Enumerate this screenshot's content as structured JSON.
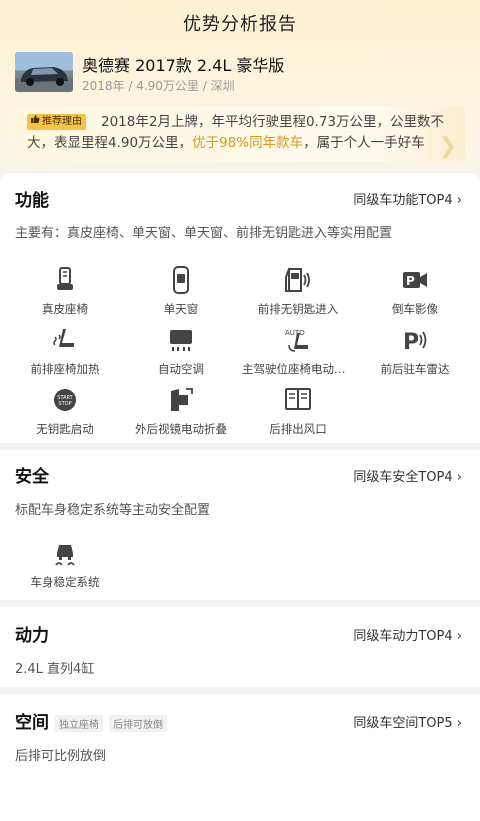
{
  "header": {
    "title": "优势分析报告"
  },
  "car": {
    "name": "奥德赛 2017款 2.4L 豪华版",
    "meta": "2018年 / 4.90万公里 / 深圳"
  },
  "reason": {
    "badge": "推荐理由",
    "text_before": "2018年2月上牌，年平均行驶里程0.73万公里，公里数不大，表显里程4.90万公里，",
    "highlight": "优于98%同年款车",
    "text_after": "，属于个人一手好车"
  },
  "sections": {
    "function": {
      "title": "功能",
      "rank": "同级车功能TOP4",
      "desc": "主要有：真皮座椅、单天窗、单天窗、前排无钥匙进入等实用配置",
      "features": [
        {
          "label": "真皮座椅",
          "icon": "leather-seat-icon"
        },
        {
          "label": "单天窗",
          "icon": "sunroof-icon"
        },
        {
          "label": "前排无钥匙进入",
          "icon": "keyless-entry-icon"
        },
        {
          "label": "倒车影像",
          "icon": "reverse-camera-icon"
        },
        {
          "label": "前排座椅加热",
          "icon": "seat-heating-icon"
        },
        {
          "label": "自动空调",
          "icon": "auto-ac-icon"
        },
        {
          "label": "主驾驶位座椅电动调节",
          "icon": "power-seat-icon"
        },
        {
          "label": "前后驻车雷达",
          "icon": "parking-radar-icon"
        },
        {
          "label": "无钥匙启动",
          "icon": "keyless-start-icon"
        },
        {
          "label": "外后视镜电动折叠",
          "icon": "mirror-fold-icon"
        },
        {
          "label": "后排出风口",
          "icon": "rear-vent-icon"
        }
      ]
    },
    "safety": {
      "title": "安全",
      "rank": "同级车安全TOP4",
      "desc": "标配车身稳定系统等主动安全配置",
      "features": [
        {
          "label": "车身稳定系统",
          "icon": "stability-control-icon"
        }
      ]
    },
    "power": {
      "title": "动力",
      "rank": "同级车动力TOP4",
      "desc": "2.4L 直列4缸"
    },
    "space": {
      "title": "空间",
      "tags": [
        "独立座椅",
        "后排可放倒"
      ],
      "rank": "同级车空间TOP5",
      "desc": "后排可比例放倒"
    }
  },
  "colors": {
    "accent": "#f6c24a",
    "highlight": "#d39a1a"
  }
}
